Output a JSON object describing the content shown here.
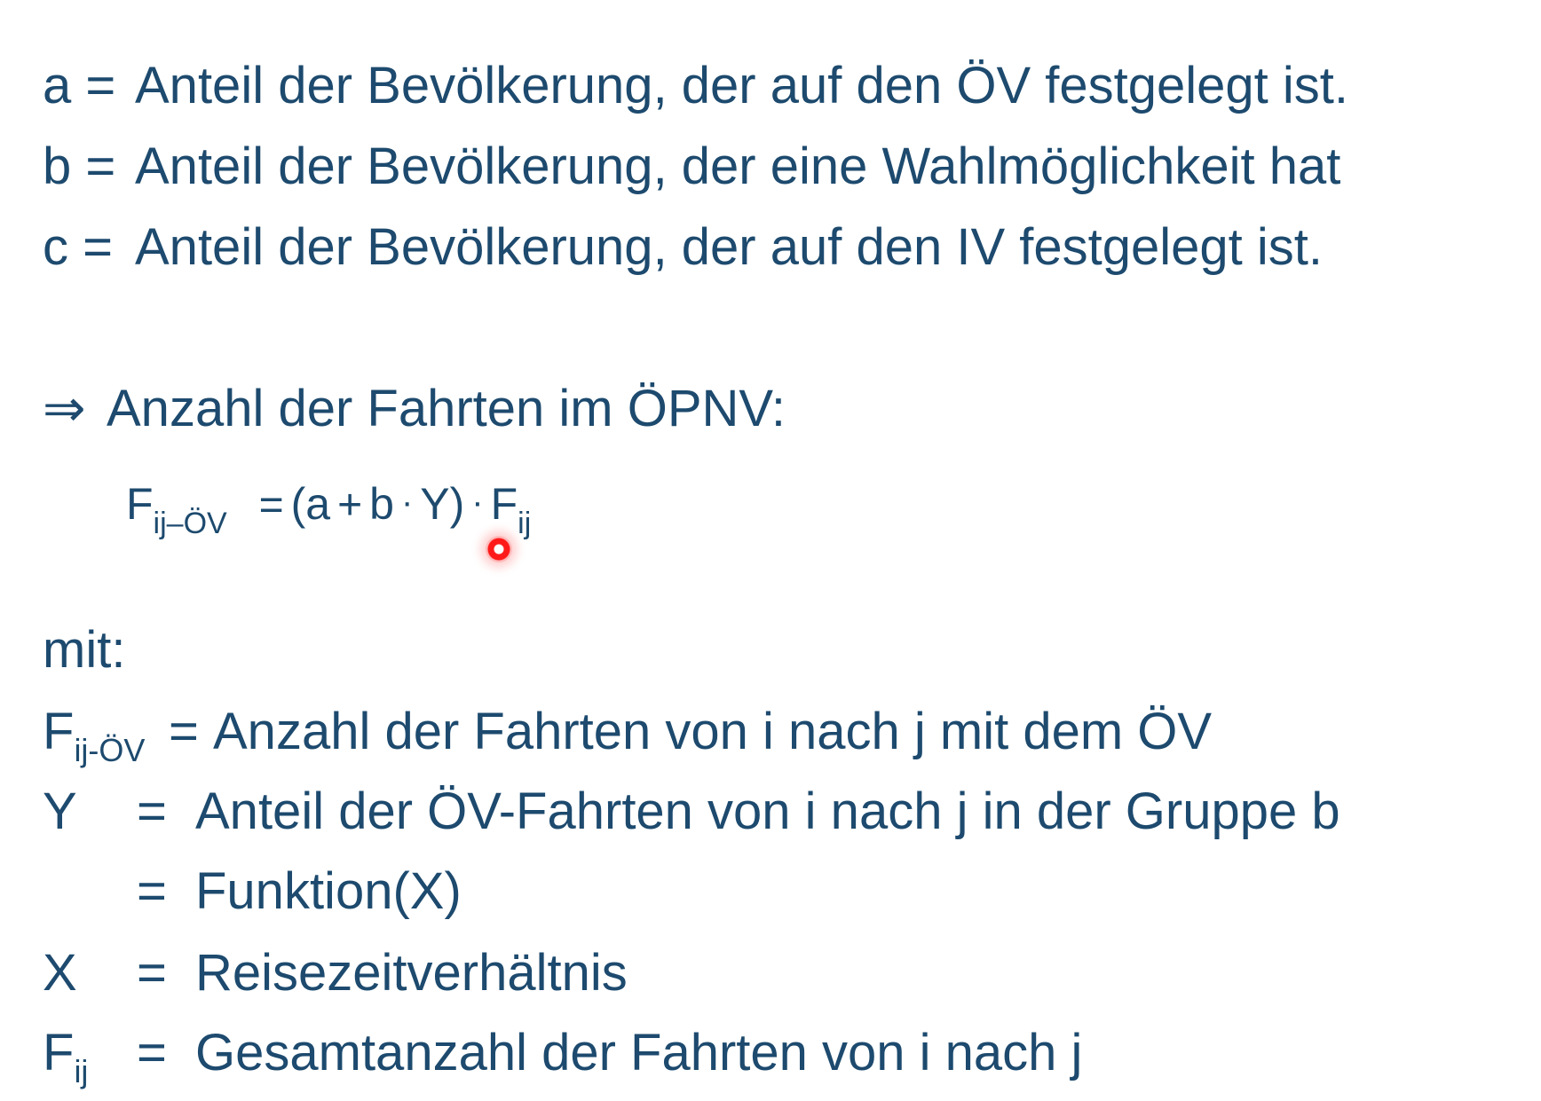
{
  "defs": [
    {
      "key": "a =",
      "text": "Anteil der Bevölkerung, der auf den ÖV festgelegt ist."
    },
    {
      "key": "b =",
      "text": "Anteil der Bevölkerung, der eine Wahlmöglichkeit hat"
    },
    {
      "key": "c =",
      "text": "Anteil der Bevölkerung, der auf den IV festgelegt ist."
    }
  ],
  "conclusion": {
    "arrow": "⇒",
    "text": "Anzahl der Fahrten im ÖPNV:"
  },
  "formula": {
    "lhs": "F",
    "lhs_sub": "ij–ÖV",
    "eq": "=",
    "open": "(",
    "a": "a",
    "plus": "+",
    "b": "b",
    "dot": "·",
    "y": "Y",
    "close": ")",
    "f": "F",
    "f_sub": "ij"
  },
  "with_label": "mit:",
  "legend": [
    {
      "sym": "F",
      "sub": "ij-ÖV",
      "eq": "=",
      "text": "Anzahl der Fahrten von i nach j mit dem ÖV"
    },
    {
      "sym": "Y",
      "sub": "",
      "eq": "=",
      "text": "Anteil der ÖV-Fahrten von i nach j in der Gruppe b"
    },
    {
      "sym": "",
      "sub": "",
      "eq": "=",
      "text": "Funktion(X)"
    },
    {
      "sym": "X",
      "sub": "",
      "eq": "=",
      "text": "Reisezeitverhältnis"
    },
    {
      "sym": "F",
      "sub": "ij",
      "eq": "=",
      "text": "Gesamtanzahl der Fahrten von i nach j"
    }
  ],
  "colors": {
    "text": "#1d4a6e",
    "cursor": "#ff1a1a"
  }
}
